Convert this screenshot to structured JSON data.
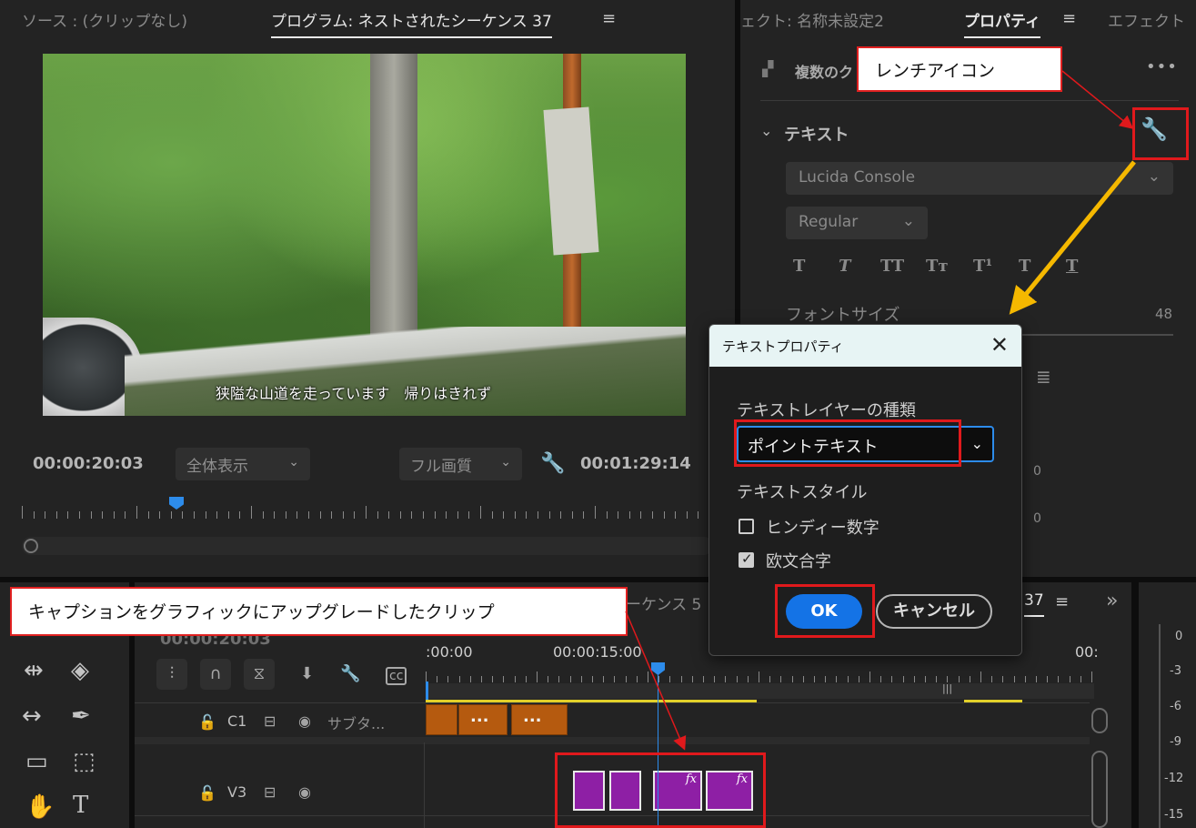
{
  "program_monitor": {
    "source_tab": "ソース : (クリップなし)",
    "program_tab": "プログラム: ネストされたシーケンス 37",
    "menu_icon": "≡",
    "video_subtitle": "狭隘な山道を走っています　帰りはきれず",
    "current_timecode": "00:00:20:03",
    "zoom_dropdown": "全体表示",
    "quality_dropdown": "フル画質",
    "duration_timecode": "00:01:29:14"
  },
  "properties_panel": {
    "effect_tab": "ェクト: 名称未設定2",
    "properties_tab": "プロパティ",
    "effect2_tab": "エフェクト",
    "multi_clip_label": "複数のク",
    "more_icon": "•••",
    "text_section": "テキスト",
    "font_family": "Lucida Console",
    "font_style": "Regular",
    "format_buttons": [
      "T",
      "T",
      "TT",
      "Tт",
      "T¹",
      "T",
      "T"
    ],
    "font_size_label": "フォントサイズ",
    "font_size_value": "48",
    "value_zero": "0"
  },
  "dialog": {
    "title": "テキストプロパティ",
    "close": "✕",
    "layer_type_label": "テキストレイヤーの種類",
    "layer_type_value": "ポイントテキスト",
    "text_style_label": "テキストスタイル",
    "checkboxes": [
      {
        "label": "ヒンディー数字",
        "checked": false
      },
      {
        "label": "欧文合字",
        "checked": true
      }
    ],
    "ok_label": "OK",
    "cancel_label": "キャンセル"
  },
  "timeline": {
    "sequence_tab_fragment": "ーケンス 5",
    "sequence_tab_suffix": "37",
    "timecode": "00:00:20:03",
    "time_labels": [
      ":00:00",
      "00:00:15:00",
      "00:"
    ],
    "tracks": [
      {
        "toggle": "C1",
        "name": "サブタ..."
      },
      {
        "toggle": "V3",
        "name": ""
      }
    ],
    "caption_clip_text": "...",
    "fx_label": "fx",
    "expand_icon": "»"
  },
  "audio_meter": {
    "ticks": [
      "0",
      "-3",
      "-6",
      "-9",
      "-12",
      "-15"
    ]
  },
  "annotations": {
    "wrench_callout": "レンチアイコン",
    "clip_callout": "キャプションをグラフィックにアップグレードしたクリップ"
  },
  "colors": {
    "accent_blue": "#1473e6",
    "annotation_red": "#e0191c",
    "arrow_yellow": "#f5b800",
    "caption_clip": "#b55a0f",
    "graphic_clip": "#8e1fa5"
  }
}
